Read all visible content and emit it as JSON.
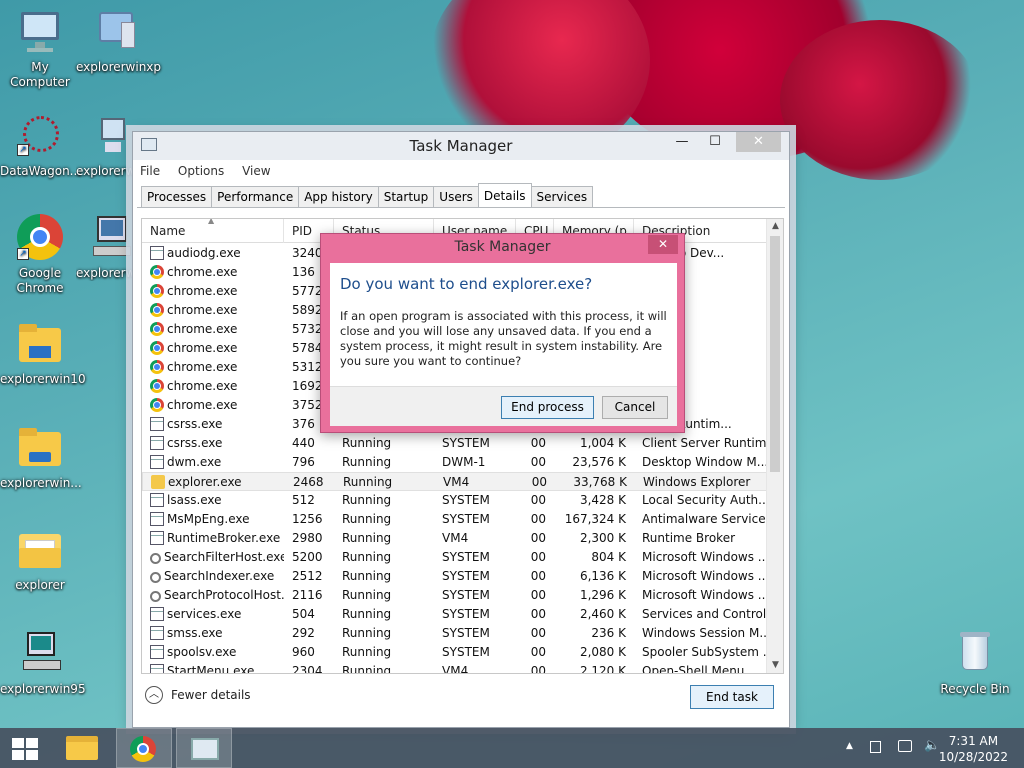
{
  "desktop": {
    "icons": [
      {
        "label": "My Computer"
      },
      {
        "label": "explorerwinxp"
      },
      {
        "label": "DataWagon..."
      },
      {
        "label": "explorerw"
      },
      {
        "label": "Google Chrome"
      },
      {
        "label": "explorerw"
      },
      {
        "label": "explorerwin10"
      },
      {
        "label": "explorerwin..."
      },
      {
        "label": "explorer"
      },
      {
        "label": "explorerwin95"
      },
      {
        "label": "Recycle Bin"
      }
    ]
  },
  "taskmanager": {
    "title": "Task Manager",
    "buttons": {
      "minimize": "—",
      "maximize": "☐",
      "close": "✕"
    },
    "menu": [
      "File",
      "Options",
      "View"
    ],
    "tabs": [
      "Processes",
      "Performance",
      "App history",
      "Startup",
      "Users",
      "Details",
      "Services"
    ],
    "active_tab": "Details",
    "columns": [
      "Name",
      "PID",
      "Status",
      "User name",
      "CPU",
      "Memory (p...",
      "Description"
    ],
    "rows": [
      {
        "name": "audiodg.exe",
        "pid": "3240",
        "status": "",
        "user": "",
        "cpu": "",
        "mem": "",
        "desc": "s Audio Dev...",
        "icon": "gen"
      },
      {
        "name": "chrome.exe",
        "pid": "136",
        "status": "",
        "user": "",
        "cpu": "",
        "mem": "",
        "desc": "hrome",
        "icon": "chrome"
      },
      {
        "name": "chrome.exe",
        "pid": "5772",
        "status": "",
        "user": "",
        "cpu": "",
        "mem": "",
        "desc": "hrome",
        "icon": "chrome"
      },
      {
        "name": "chrome.exe",
        "pid": "5892",
        "status": "",
        "user": "",
        "cpu": "",
        "mem": "",
        "desc": "hrome",
        "icon": "chrome"
      },
      {
        "name": "chrome.exe",
        "pid": "5732",
        "status": "",
        "user": "",
        "cpu": "",
        "mem": "",
        "desc": "hrome",
        "icon": "chrome"
      },
      {
        "name": "chrome.exe",
        "pid": "5784",
        "status": "",
        "user": "",
        "cpu": "",
        "mem": "",
        "desc": "hrome",
        "icon": "chrome"
      },
      {
        "name": "chrome.exe",
        "pid": "5312",
        "status": "",
        "user": "",
        "cpu": "",
        "mem": "",
        "desc": "hrome",
        "icon": "chrome"
      },
      {
        "name": "chrome.exe",
        "pid": "1692",
        "status": "",
        "user": "",
        "cpu": "",
        "mem": "",
        "desc": "hrome",
        "icon": "chrome"
      },
      {
        "name": "chrome.exe",
        "pid": "3752",
        "status": "",
        "user": "",
        "cpu": "",
        "mem": "",
        "desc": "hrome",
        "icon": "chrome"
      },
      {
        "name": "csrss.exe",
        "pid": "376",
        "status": "",
        "user": "",
        "cpu": "",
        "mem": "",
        "desc": "erver Runtim...",
        "icon": "gen"
      },
      {
        "name": "csrss.exe",
        "pid": "440",
        "status": "Running",
        "user": "SYSTEM",
        "cpu": "00",
        "mem": "1,004 K",
        "desc": "Client Server Runtim...",
        "icon": "gen"
      },
      {
        "name": "dwm.exe",
        "pid": "796",
        "status": "Running",
        "user": "DWM-1",
        "cpu": "00",
        "mem": "23,576 K",
        "desc": "Desktop Window M...",
        "icon": "gen"
      },
      {
        "name": "explorer.exe",
        "pid": "2468",
        "status": "Running",
        "user": "VM4",
        "cpu": "00",
        "mem": "33,768 K",
        "desc": "Windows Explorer",
        "icon": "fold",
        "selected": true
      },
      {
        "name": "lsass.exe",
        "pid": "512",
        "status": "Running",
        "user": "SYSTEM",
        "cpu": "00",
        "mem": "3,428 K",
        "desc": "Local Security Auth...",
        "icon": "gen"
      },
      {
        "name": "MsMpEng.exe",
        "pid": "1256",
        "status": "Running",
        "user": "SYSTEM",
        "cpu": "00",
        "mem": "167,324 K",
        "desc": "Antimalware Service...",
        "icon": "gen"
      },
      {
        "name": "RuntimeBroker.exe",
        "pid": "2980",
        "status": "Running",
        "user": "VM4",
        "cpu": "00",
        "mem": "2,300 K",
        "desc": "Runtime Broker",
        "icon": "gen"
      },
      {
        "name": "SearchFilterHost.exe",
        "pid": "5200",
        "status": "Running",
        "user": "SYSTEM",
        "cpu": "00",
        "mem": "804 K",
        "desc": "Microsoft Windows ...",
        "icon": "srch"
      },
      {
        "name": "SearchIndexer.exe",
        "pid": "2512",
        "status": "Running",
        "user": "SYSTEM",
        "cpu": "00",
        "mem": "6,136 K",
        "desc": "Microsoft Windows ...",
        "icon": "srch"
      },
      {
        "name": "SearchProtocolHost....",
        "pid": "2116",
        "status": "Running",
        "user": "SYSTEM",
        "cpu": "00",
        "mem": "1,296 K",
        "desc": "Microsoft Windows ...",
        "icon": "srch"
      },
      {
        "name": "services.exe",
        "pid": "504",
        "status": "Running",
        "user": "SYSTEM",
        "cpu": "00",
        "mem": "2,460 K",
        "desc": "Services and Control...",
        "icon": "gen"
      },
      {
        "name": "smss.exe",
        "pid": "292",
        "status": "Running",
        "user": "SYSTEM",
        "cpu": "00",
        "mem": "236 K",
        "desc": "Windows Session M...",
        "icon": "gen"
      },
      {
        "name": "spoolsv.exe",
        "pid": "960",
        "status": "Running",
        "user": "SYSTEM",
        "cpu": "00",
        "mem": "2,080 K",
        "desc": "Spooler SubSystem ...",
        "icon": "gen"
      },
      {
        "name": "StartMenu.exe",
        "pid": "2304",
        "status": "Running",
        "user": "VM4",
        "cpu": "00",
        "mem": "2,120 K",
        "desc": "Open-Shell Menu",
        "icon": "gen"
      }
    ],
    "fewer_details": "Fewer details",
    "end_task": "End task"
  },
  "dialog": {
    "title": "Task Manager",
    "close": "✕",
    "heading": "Do you want to end explorer.exe?",
    "text": "If an open program is associated with this process, it will close and you will lose any unsaved data. If you end a system process, it might result in system instability. Are you sure you want to continue?",
    "end_process": "End process",
    "cancel": "Cancel"
  },
  "taskbar": {
    "time": "7:31 AM",
    "date": "10/28/2022"
  }
}
